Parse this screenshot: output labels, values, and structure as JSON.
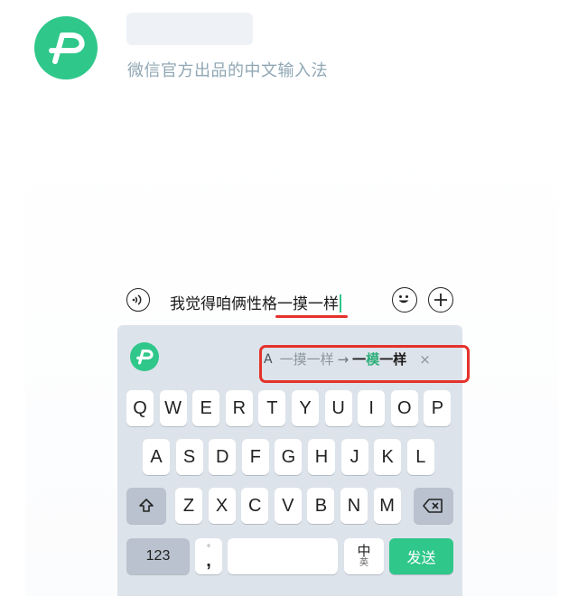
{
  "header": {
    "subtitle": "微信官方出品的中文输入法"
  },
  "input": {
    "text_before": "我觉得咱俩性格",
    "text_highlight": "一摸一样"
  },
  "suggestion": {
    "spell_icon": "A",
    "from": "一摸一样",
    "arrow": "→",
    "to_start": "一",
    "to_changed": "模",
    "to_end": "一样",
    "close": "×"
  },
  "keyboard": {
    "row1": [
      "Q",
      "W",
      "E",
      "R",
      "T",
      "Y",
      "U",
      "I",
      "O",
      "P"
    ],
    "row2": [
      "A",
      "S",
      "D",
      "F",
      "G",
      "H",
      "J",
      "K",
      "L"
    ],
    "row3": [
      "Z",
      "X",
      "C",
      "V",
      "B",
      "N",
      "M"
    ],
    "numbers_label": "123",
    "punct_top": "°",
    "punct_main": ",",
    "lang_main": "中",
    "lang_sub": "英",
    "send_label": "发送"
  },
  "colors": {
    "brand": "#2fc78a",
    "annotation_red": "#e4322b",
    "keyboard_bg": "#dde3ea"
  }
}
